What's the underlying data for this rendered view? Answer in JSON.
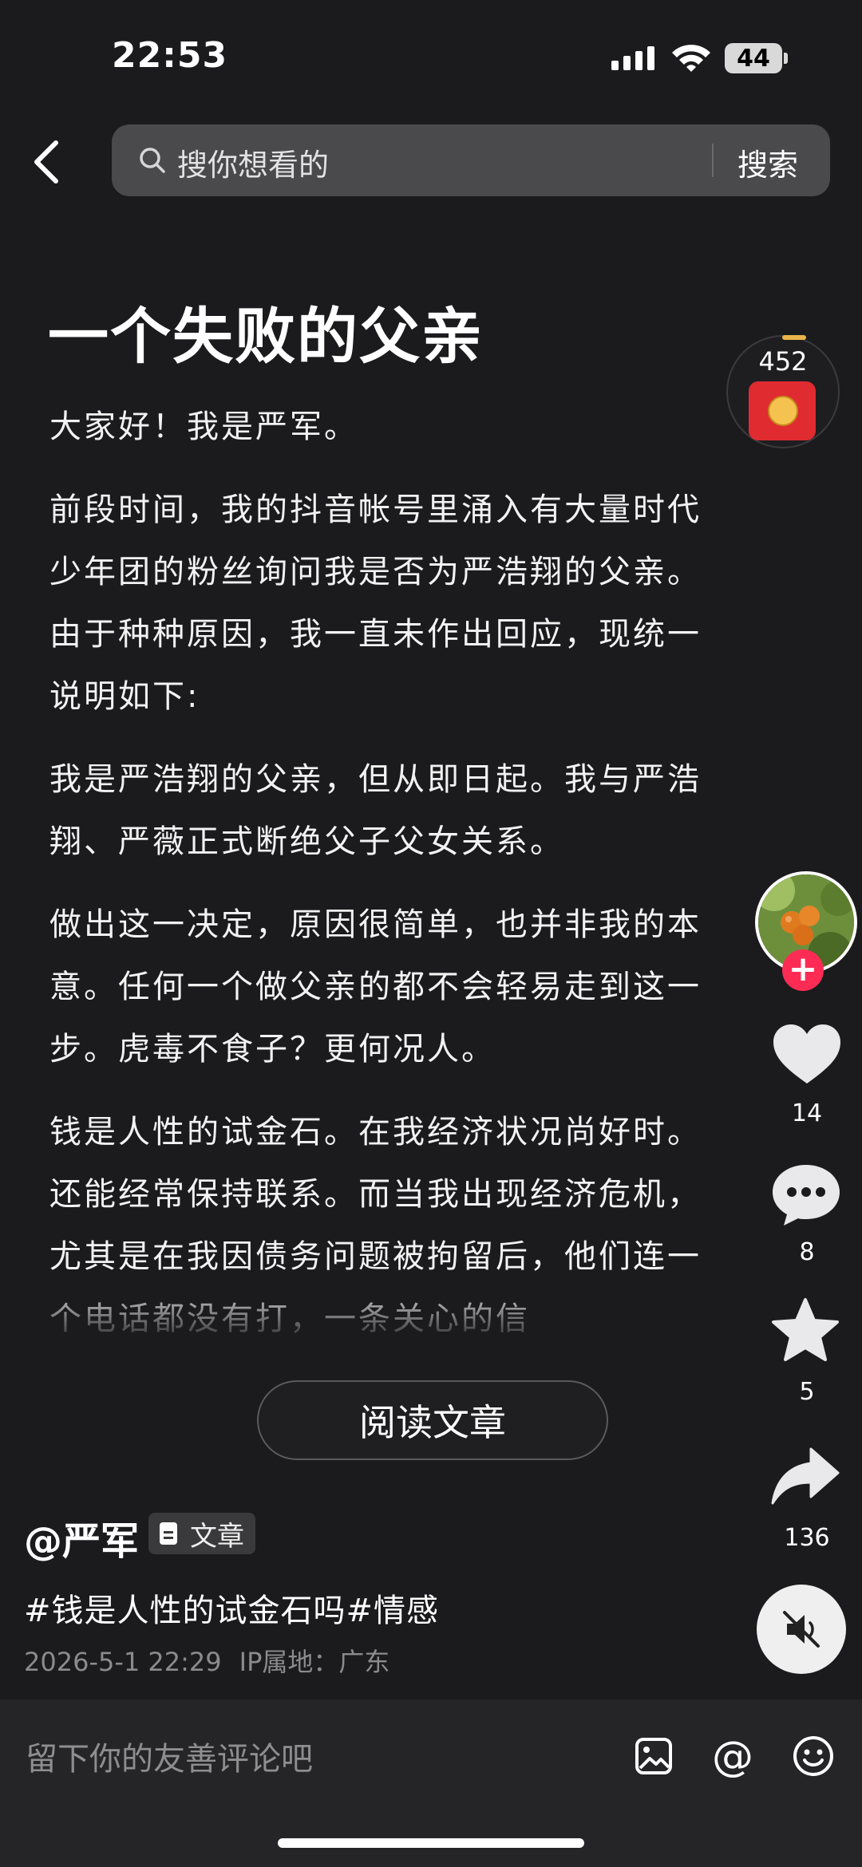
{
  "status_bar": {
    "time": "22:53",
    "battery": "44"
  },
  "search": {
    "placeholder": "搜你想看的",
    "button_label": "搜索"
  },
  "article": {
    "title": "一个失败的父亲",
    "paragraphs": [
      "大家好！我是严军。",
      "前段时间，我的抖音帐号里涌入有大量时代少年团的粉丝询问我是否为严浩翔的父亲。由于种种原因，我一直未作出回应，现统一说明如下:",
      "我是严浩翔的父亲，但从即日起。我与严浩翔、严薇正式断绝父子父女关系。",
      "做出这一决定，原因很简单，也并非我的本意。任何一个做父亲的都不会轻易走到这一步。虎毒不食子？更何况人。",
      "钱是人性的试金石。在我经济状况尚好时。还能经常保持联系。而当我出现经济危机，尤其是在我因债务问题被拘留后，他们连一个电话都没有打，一条关心的信"
    ],
    "read_button": "阅读文章"
  },
  "right_rail": {
    "red_packet_count": "452",
    "like_count": "14",
    "comment_count": "8",
    "favorite_count": "5",
    "share_count": "136"
  },
  "post": {
    "author": "@严军",
    "tag": "文章",
    "hashtags": [
      "#钱是人性的试金石吗",
      "#情感"
    ],
    "time": "2026-5-1 22:29",
    "location": "IP属地：广东"
  },
  "comment_bar": {
    "placeholder": "留下你的友善评论吧",
    "at_symbol": "@"
  },
  "colors": {
    "background": "#1b1b1d",
    "search_bg": "#4a4a4c",
    "follow_red": "#fe2c55",
    "muted_text": "#8b8b8e"
  }
}
